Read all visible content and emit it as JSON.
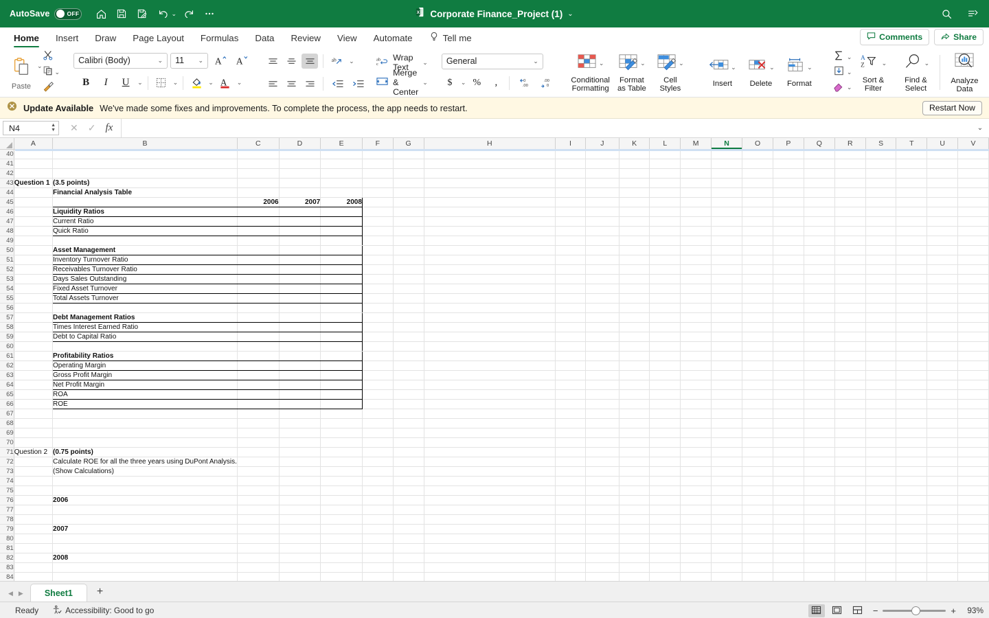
{
  "titlebar": {
    "autosave_label": "AutoSave",
    "autosave_state": "OFF",
    "document_title": "Corporate Finance_Project (1)",
    "icons": [
      "home-icon",
      "save-icon",
      "save-as-icon",
      "undo-icon",
      "redo-icon",
      "more-commands-icon"
    ],
    "right_icons": [
      "search-icon",
      "ribbon-display-options-icon"
    ]
  },
  "ribbon_tabs": {
    "items": [
      {
        "label": "Home",
        "active": true
      },
      {
        "label": "Insert",
        "active": false
      },
      {
        "label": "Draw",
        "active": false
      },
      {
        "label": "Page Layout",
        "active": false
      },
      {
        "label": "Formulas",
        "active": false
      },
      {
        "label": "Data",
        "active": false
      },
      {
        "label": "Review",
        "active": false
      },
      {
        "label": "View",
        "active": false
      },
      {
        "label": "Automate",
        "active": false
      }
    ],
    "tell_me": "Tell me",
    "comments": "Comments",
    "share": "Share"
  },
  "ribbon": {
    "paste_label": "Paste",
    "font_name": "Calibri (Body)",
    "font_size": "11",
    "wrap_text": "Wrap Text",
    "merge_center": "Merge & Center",
    "number_format": "General",
    "conditional_formatting": "Conditional\nFormatting",
    "conditional_formatting_l1": "Conditional",
    "conditional_formatting_l2": "Formatting",
    "format_as_table_l1": "Format",
    "format_as_table_l2": "as Table",
    "cell_styles_l1": "Cell",
    "cell_styles_l2": "Styles",
    "insert": "Insert",
    "delete": "Delete",
    "format": "Format",
    "sort_filter_l1": "Sort &",
    "sort_filter_l2": "Filter",
    "find_select_l1": "Find &",
    "find_select_l2": "Select",
    "analyze_data_l1": "Analyze",
    "analyze_data_l2": "Data"
  },
  "notification": {
    "title": "Update Available",
    "message": "We've made some fixes and improvements. To complete the process, the app needs to restart.",
    "button": "Restart Now"
  },
  "formula_bar": {
    "name_box": "N4",
    "formula": "",
    "cancel_icon": "cancel-icon",
    "enter_icon": "enter-icon",
    "function_icon": "insert-function-icon"
  },
  "grid": {
    "columns": [
      "A",
      "B",
      "C",
      "D",
      "E",
      "F",
      "G",
      "H",
      "I",
      "J",
      "K",
      "L",
      "M",
      "N",
      "O",
      "P",
      "Q",
      "R",
      "S",
      "T",
      "U",
      "V"
    ],
    "active_column": "N",
    "first_row": 40,
    "last_row": 84,
    "cells": {
      "A43": "Question 1",
      "B43": "(3.5 points)",
      "B44": "Financial Analysis Table",
      "C45": "2006",
      "D45": "2007",
      "E45": "2008",
      "B46": "Liquidity Ratios",
      "B47": "Current Ratio",
      "B48": "Quick Ratio",
      "B50": "Asset Management",
      "B51": "Inventory Turnover Ratio",
      "B52": "Receivables Turnover Ratio",
      "B53": "Days Sales Outstanding",
      "B54": "Fixed Asset Turnover",
      "B55": "Total Assets Turnover",
      "B57": "Debt Management Ratios",
      "B58": "Times Interest Earned Ratio",
      "B59": "Debt to Capital Ratio",
      "B61": "Profitability Ratios",
      "B62": "Operating Margin",
      "B63": "Gross Profit Margin",
      "B64": "Net Profit Margin",
      "B65": "ROA",
      "B66": "ROE",
      "A71": "Question 2",
      "B71": "(0.75 points)",
      "B72": "Calculate ROE for all the three years using DuPont Analysis.",
      "B73": "(Show Calculations)",
      "B76": "2006",
      "B79": "2007",
      "B82": "2008"
    }
  },
  "sheet_tabs": {
    "sheets": [
      {
        "name": "Sheet1",
        "active": true
      }
    ],
    "add_label": "+"
  },
  "status_bar": {
    "ready": "Ready",
    "accessibility": "Accessibility: Good to go",
    "zoom": "93%",
    "views": [
      "normal-view-icon",
      "page-layout-view-icon",
      "page-break-view-icon"
    ]
  }
}
